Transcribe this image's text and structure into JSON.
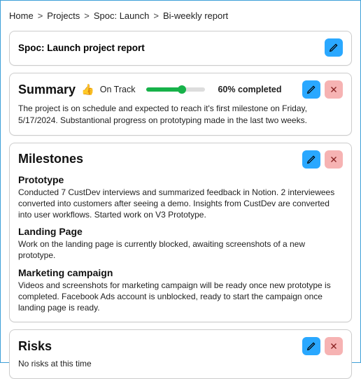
{
  "breadcrumb": {
    "items": [
      "Home",
      "Projects",
      "Spoc: Launch",
      "Bi-weekly report"
    ]
  },
  "header": {
    "title": "Spoc: Launch project report"
  },
  "summary": {
    "label": "Summary",
    "status_icon": "👍",
    "status_text": "On Track",
    "progress_pct": 60,
    "completed_text": "60% completed",
    "description": "The project is on schedule and expected to reach it's first milestone on Friday, 5/17/2024. Substantional progress on prototyping made in the last two weeks."
  },
  "milestones": {
    "label": "Milestones",
    "items": [
      {
        "title": "Prototype",
        "desc": "Conducted 7 CustDev interviews and summarized feedback in Notion. 2 interviewees converted into customers after seeing a demo. Insights from CustDev are converted into user workflows. Started work on V3 Prototype."
      },
      {
        "title": "Landing Page",
        "desc": "Work on the landing page is currently blocked, awaiting screenshots of a new prototype."
      },
      {
        "title": "Marketing campaign",
        "desc": "Videos and screenshots for marketing campaign will be ready once new prototype is completed. Facebook Ads account is unblocked, ready to start the campaign once landing page is ready."
      }
    ]
  },
  "risks": {
    "label": "Risks",
    "description": "No risks at this time"
  },
  "icons": {
    "edit": "pencil-icon",
    "delete": "close-icon"
  },
  "colors": {
    "accent_blue": "#2aa8ff",
    "accent_red": "#f6b3b3",
    "progress_green": "#17b24a"
  }
}
